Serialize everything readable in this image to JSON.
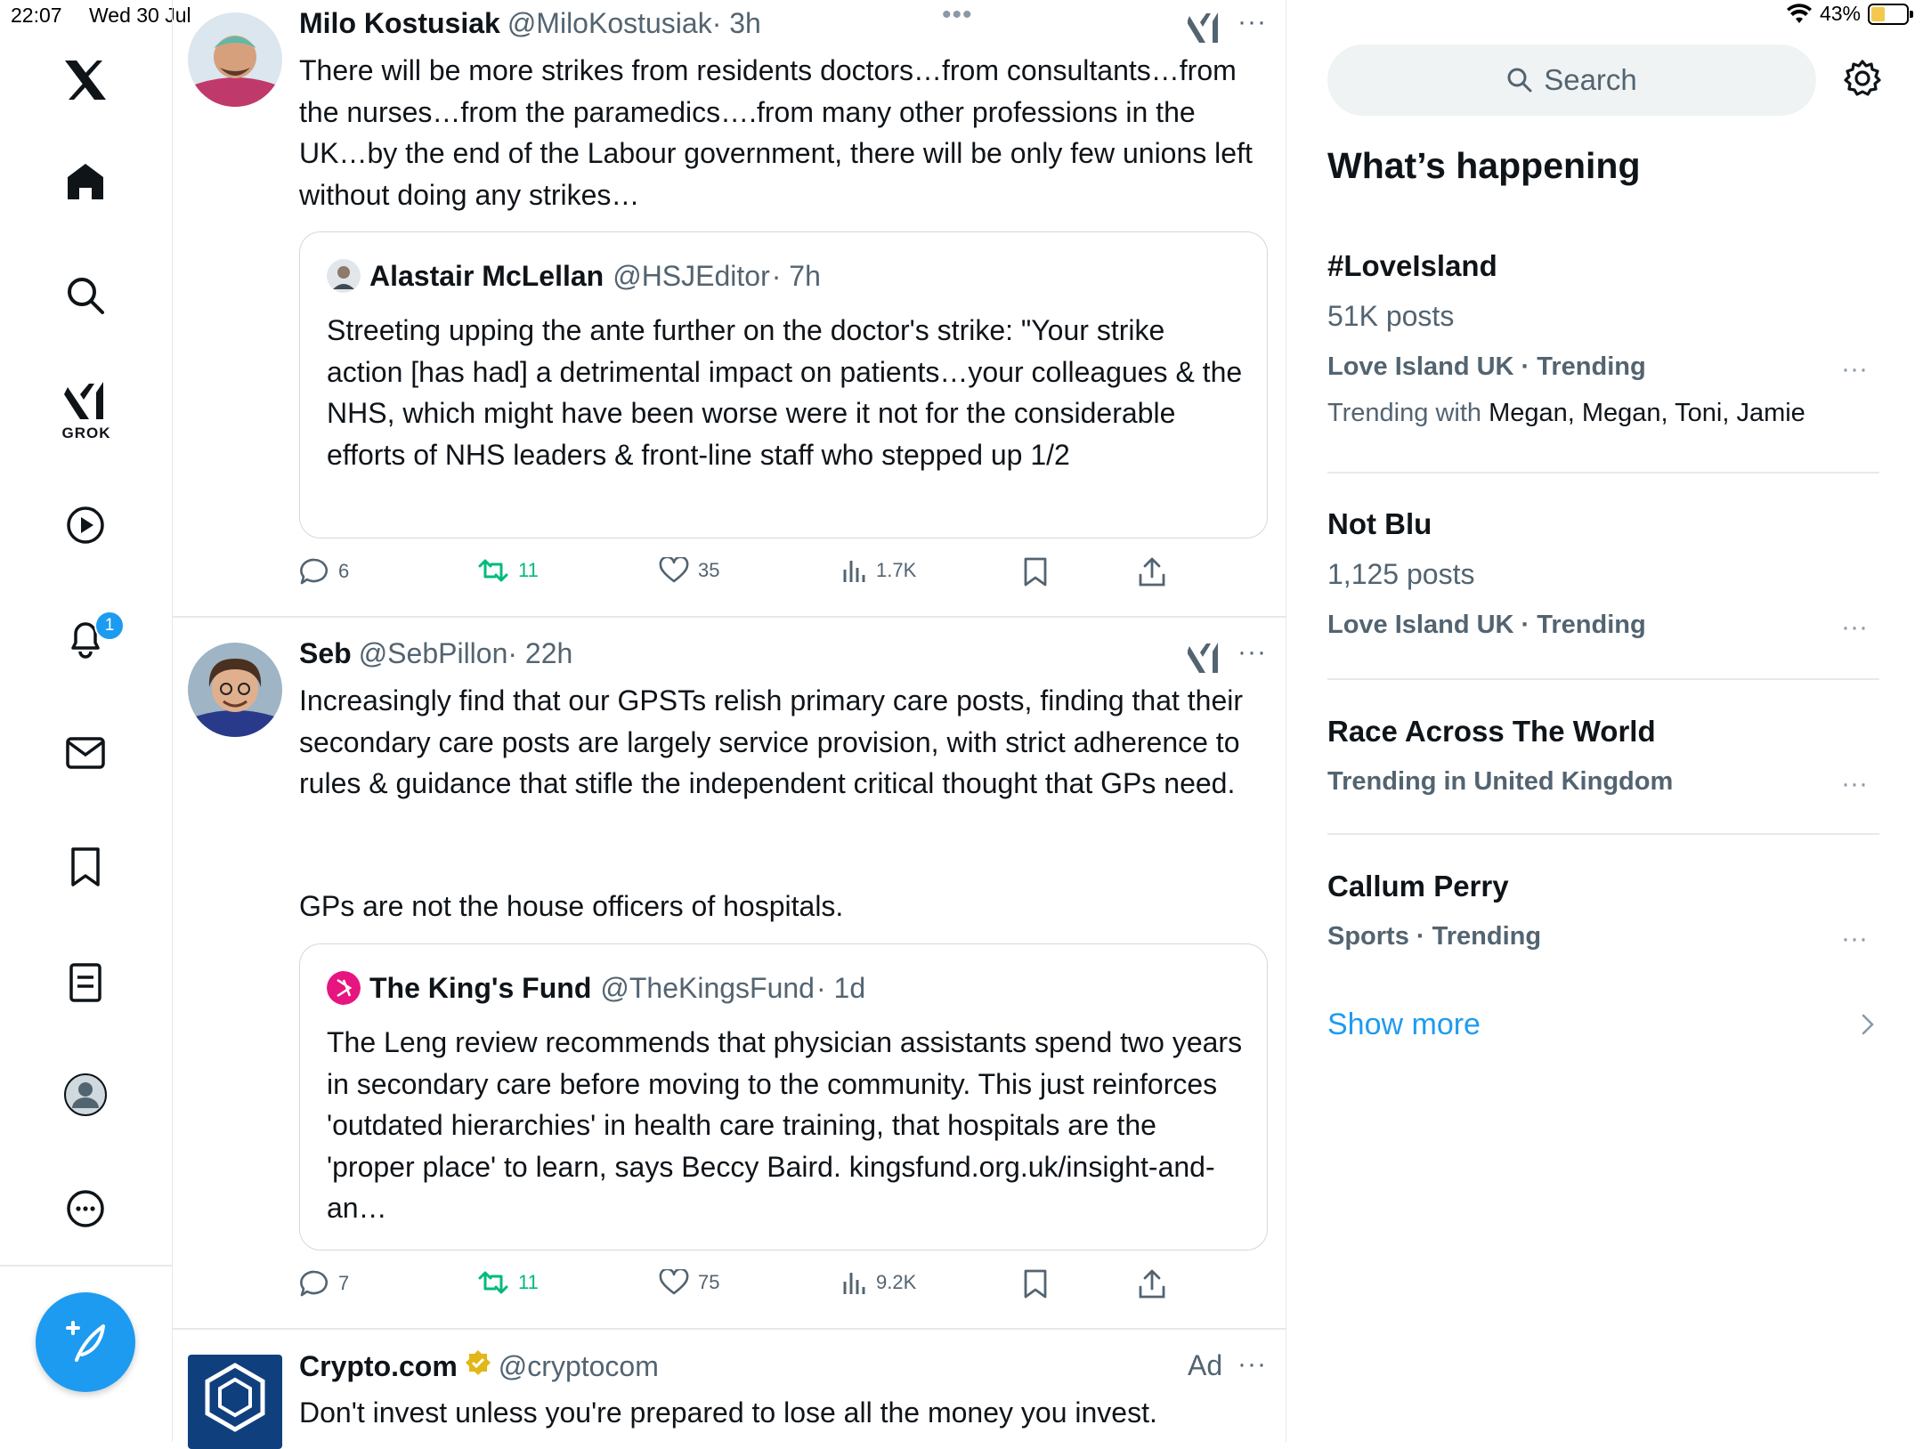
{
  "status": {
    "time": "22:07",
    "date": "Wed 30 Jul",
    "battery": "43%",
    "battery_level": 0.43
  },
  "nav": {
    "grok_label": "GROK",
    "notifications_badge": "1",
    "items": [
      "x-logo-icon",
      "home-icon",
      "search-icon",
      "grok-icon",
      "video-icon",
      "notifications-icon",
      "messages-icon",
      "bookmarks-icon",
      "lists-icon",
      "profile-icon",
      "more-icon"
    ]
  },
  "tweets": [
    {
      "name": "Milo Kostusiak",
      "handle": "@MiloKostusiak",
      "time": "· 3h",
      "text": "There will be more strikes from residents doctors…from consultants…from the nurses…from the paramedics….from many other professions in the UK…by the end of the Labour government, there will be only few unions left without doing any strikes…",
      "quote": {
        "name": "Alastair McLellan",
        "handle": "@HSJEditor",
        "time": "· 7h",
        "text": "Streeting upping the ante further on the doctor's strike: \"Your strike action [has had] a detrimental impact on patients…your colleagues & the NHS, which might have been worse were it not for the considerable efforts of NHS leaders & front-line staff who stepped up 1/2"
      },
      "replies": "6",
      "reposts": "11",
      "likes": "35",
      "views": "1.7K"
    },
    {
      "name": "Seb",
      "handle": "@SebPillon",
      "time": "· 22h",
      "text": "Increasingly find that our GPSTs relish primary care posts, finding that their secondary care posts are largely service provision, with strict adherence to rules & guidance that stifle the independent critical thought that GPs need.",
      "text2": "GPs are not the house officers of hospitals.",
      "quote": {
        "name": "The King's Fund",
        "handle": "@TheKingsFund",
        "time": "· 1d",
        "text": "The Leng review recommends that physician assistants spend two years in secondary care before moving to the community. This just reinforces 'outdated hierarchies' in health care training, that hospitals are the 'proper place' to learn, says Beccy Baird. kingsfund.org.uk/insight-and-an…"
      },
      "replies": "7",
      "reposts": "11",
      "likes": "75",
      "views": "9.2K"
    },
    {
      "name": "Crypto.com",
      "handle": "@cryptocom",
      "ad_label": "Ad",
      "text": "Don't invest unless you're prepared to lose all the money you invest."
    }
  ],
  "sidebar": {
    "search_placeholder": "Search",
    "whats_happening": "What’s happening",
    "trends": [
      {
        "title": "#LoveIsland",
        "posts": "51K posts",
        "meta": "Love Island UK · Trending",
        "with_label": "Trending with",
        "with_names": "Megan, Megan, Toni, Jamie"
      },
      {
        "title": "Not Blu",
        "posts": "1,125 posts",
        "meta": "Love Island UK · Trending"
      },
      {
        "title": "Race Across The World",
        "meta": "Trending in United Kingdom"
      },
      {
        "title": "Callum Perry",
        "meta": "Sports · Trending"
      }
    ],
    "show_more": "Show more"
  },
  "colors": {
    "accent": "#1d9bf0",
    "repost": "#00ba7c",
    "secondary_text": "#536471",
    "border": "#e6e9ec"
  }
}
